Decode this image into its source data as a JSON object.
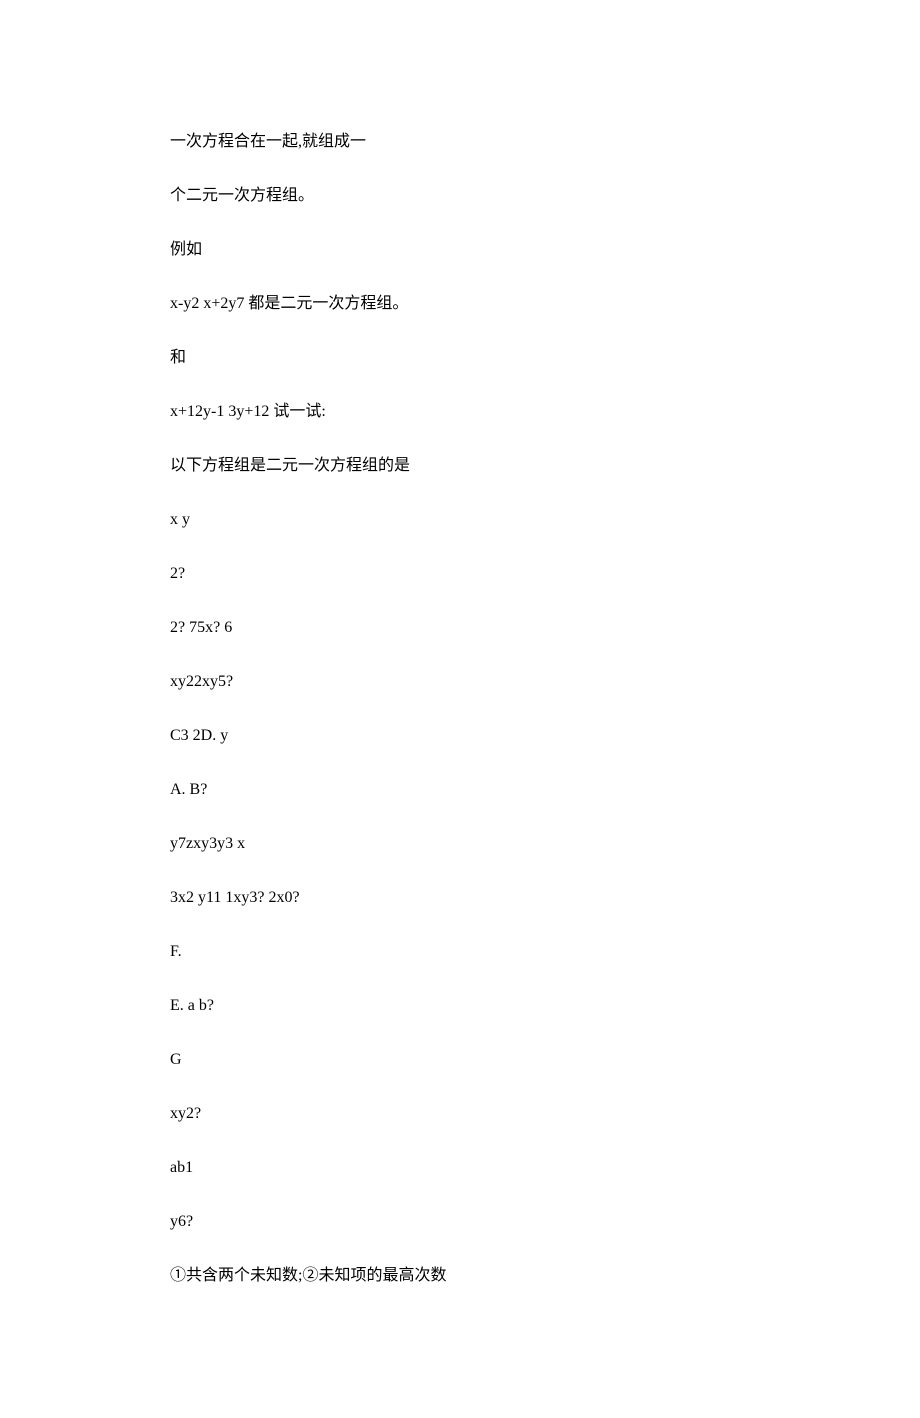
{
  "lines": [
    "一次方程合在一起,就组成一",
    "个二元一次方程组。",
    "例如",
    "x-y2 x+2y7 都是二元一次方程组。",
    "和",
    "x+12y-1 3y+12 试一试:",
    "以下方程组是二元一次方程组的是",
    "x y",
    "2?",
    "2? 75x? 6",
    "xy22xy5?",
    "C3 2D. y",
    "A. B?",
    "y7zxy3y3 x",
    "3x2 y11 1xy3? 2x0?",
    "F.",
    "E. a b?",
    "G",
    "xy2?",
    "ab1",
    "y6?",
    "①共含两个未知数;②未知项的最高次数"
  ]
}
